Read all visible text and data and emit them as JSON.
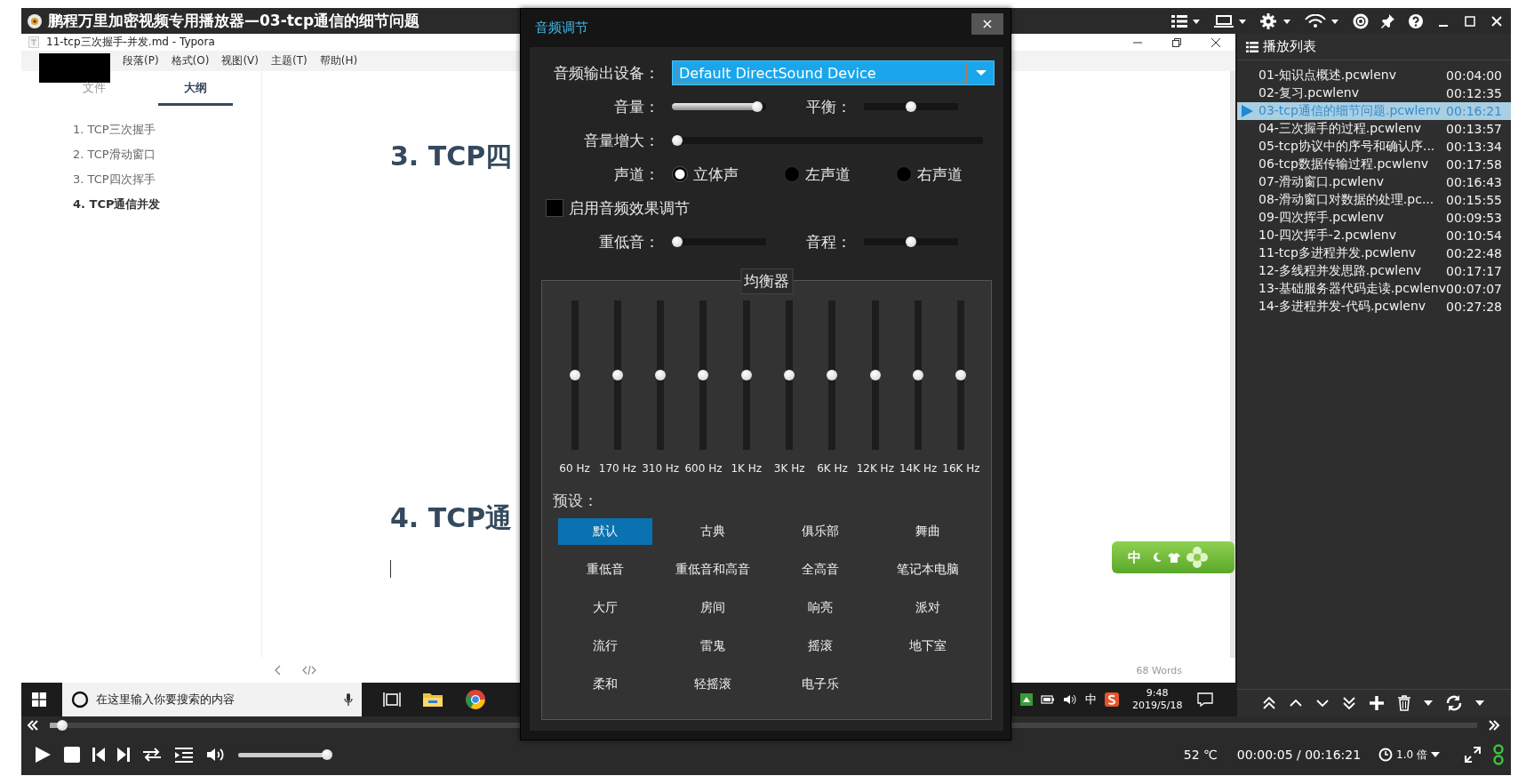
{
  "player": {
    "title": "鹏程万里加密视频专用播放器—03-tcp通信的细节问题"
  },
  "typora": {
    "title": "11-tcp三次握手-并发.md - Typora",
    "menu": [
      "段落(P)",
      "格式(O)",
      "视图(V)",
      "主题(T)",
      "帮助(H)"
    ],
    "sidebar_tabs": [
      {
        "label": "文件",
        "selected": false
      },
      {
        "label": "大纲",
        "selected": true
      }
    ],
    "outline": [
      {
        "label": "1. TCP三次握手",
        "selected": false
      },
      {
        "label": "2. TCP滑动窗口",
        "selected": false
      },
      {
        "label": "3. TCP四次挥手",
        "selected": false
      },
      {
        "label": "4. TCP通信并发",
        "selected": true
      }
    ],
    "headings": [
      "3. TCP四",
      "4. TCP通"
    ],
    "word_count": "68 Words"
  },
  "taskbar": {
    "search_placeholder": "在这里输入你要搜索的内容",
    "ime": "中",
    "time": "9:48",
    "date": "2019/5/18"
  },
  "ime_toolbar": {
    "label": "中"
  },
  "dialog": {
    "title": "音频调节",
    "close": "×",
    "device_label": "音频输出设备：",
    "device": "Default DirectSound Device",
    "volume": {
      "label": "音量：",
      "level": 0.96
    },
    "balance": {
      "label": "平衡：",
      "level": 0.5
    },
    "boost": {
      "label": "音量增大：",
      "level": 0
    },
    "channel": {
      "label": "声道：",
      "options": [
        {
          "label": "立体声",
          "selected": true
        },
        {
          "label": "左声道",
          "selected": false
        },
        {
          "label": "右声道",
          "selected": false
        }
      ]
    },
    "effects": {
      "label": "启用音频效果调节",
      "checked": false
    },
    "bass": {
      "label": "重低音：",
      "level": 0
    },
    "pitch": {
      "label": "音程：",
      "level": 0.5
    },
    "equalizer": {
      "title": "均衡器",
      "bands": [
        {
          "label": "60 Hz",
          "level": 0.5
        },
        {
          "label": "170 Hz",
          "level": 0.5
        },
        {
          "label": "310 Hz",
          "level": 0.5
        },
        {
          "label": "600 Hz",
          "level": 0.5
        },
        {
          "label": "1K Hz",
          "level": 0.5
        },
        {
          "label": "3K Hz",
          "level": 0.5
        },
        {
          "label": "6K Hz",
          "level": 0.5
        },
        {
          "label": "12K Hz",
          "level": 0.5
        },
        {
          "label": "14K Hz",
          "level": 0.5
        },
        {
          "label": "16K Hz",
          "level": 0.5
        }
      ]
    },
    "presets": {
      "label": "预设：",
      "items": [
        {
          "label": "默认",
          "selected": true
        },
        {
          "label": "古典",
          "selected": false
        },
        {
          "label": "俱乐部",
          "selected": false
        },
        {
          "label": "舞曲",
          "selected": false
        },
        {
          "label": "重低音",
          "selected": false
        },
        {
          "label": "重低音和高音",
          "selected": false
        },
        {
          "label": "全高音",
          "selected": false
        },
        {
          "label": "笔记本电脑",
          "selected": false
        },
        {
          "label": "大厅",
          "selected": false
        },
        {
          "label": "房间",
          "selected": false
        },
        {
          "label": "响亮",
          "selected": false
        },
        {
          "label": "派对",
          "selected": false
        },
        {
          "label": "流行",
          "selected": false
        },
        {
          "label": "雷鬼",
          "selected": false
        },
        {
          "label": "摇滚",
          "selected": false
        },
        {
          "label": "地下室",
          "selected": false
        },
        {
          "label": "柔和",
          "selected": false
        },
        {
          "label": "轻摇滚",
          "selected": false
        },
        {
          "label": "电子乐",
          "selected": false
        }
      ]
    }
  },
  "playlist": {
    "title": "播放列表",
    "items": [
      {
        "name": "01-知识点概述.pcwlenv",
        "duration": "00:04:00",
        "selected": false
      },
      {
        "name": "02-复习.pcwlenv",
        "duration": "00:12:35",
        "selected": false
      },
      {
        "name": "03-tcp通信的细节问题.pcwlenv",
        "duration": "00:16:21",
        "selected": true
      },
      {
        "name": "04-三次握手的过程.pcwlenv",
        "duration": "00:13:57",
        "selected": false
      },
      {
        "name": "05-tcp协议中的序号和确认序...",
        "duration": "00:13:34",
        "selected": false
      },
      {
        "name": "06-tcp数据传输过程.pcwlenv",
        "duration": "00:17:58",
        "selected": false
      },
      {
        "name": "07-滑动窗口.pcwlenv",
        "duration": "00:16:43",
        "selected": false
      },
      {
        "name": "08-滑动窗口对数据的处理.pc...",
        "duration": "00:15:55",
        "selected": false
      },
      {
        "name": "09-四次挥手.pcwlenv",
        "duration": "00:09:53",
        "selected": false
      },
      {
        "name": "10-四次挥手-2.pcwlenv",
        "duration": "00:10:54",
        "selected": false
      },
      {
        "name": "11-tcp多进程并发.pcwlenv",
        "duration": "00:22:48",
        "selected": false
      },
      {
        "name": "12-多线程并发思路.pcwlenv",
        "duration": "00:17:17",
        "selected": false
      },
      {
        "name": "13-基础服务器代码走读.pcwlenv",
        "duration": "00:07:07",
        "selected": false
      },
      {
        "name": "14-多进程并发-代码.pcwlenv",
        "duration": "00:27:28",
        "selected": false
      }
    ]
  },
  "controls": {
    "seek": {
      "level": 0.005
    },
    "volume": {
      "level": 1.0
    },
    "temperature": "52 ℃",
    "time": "00:00:05 / 00:16:21",
    "speed": "1.0 倍"
  }
}
